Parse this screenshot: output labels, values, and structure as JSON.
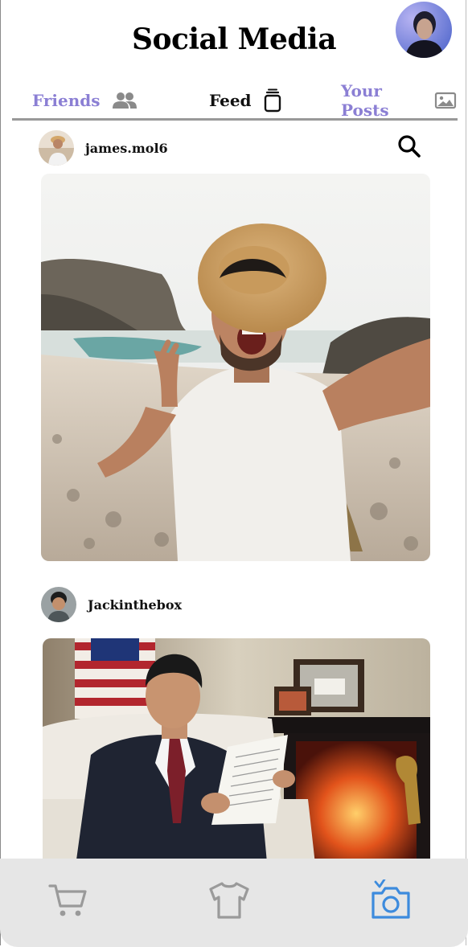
{
  "header": {
    "title": "Social Media",
    "profile_avatar": "user-avatar"
  },
  "tabs": [
    {
      "label": "Friends",
      "icon": "people-icon",
      "active": false
    },
    {
      "label": "Feed",
      "icon": "stack-icon",
      "active": true
    },
    {
      "label": "Your Posts",
      "icon": "image-icon",
      "active": false
    }
  ],
  "posts": [
    {
      "username": "james.mol6",
      "image": "beach-selfie-photo"
    },
    {
      "username": "Jackinthebox",
      "image": "office-portrait-photo"
    }
  ],
  "bottom_nav": [
    {
      "icon": "cart-icon",
      "active": false
    },
    {
      "icon": "shirt-icon",
      "active": false
    },
    {
      "icon": "camera-icon",
      "active": true
    }
  ],
  "colors": {
    "accent": "#8b7fd4",
    "active_nav": "#3d8bdd",
    "inactive_nav": "#9a9a9a",
    "nav_bg": "#e6e6e6"
  }
}
